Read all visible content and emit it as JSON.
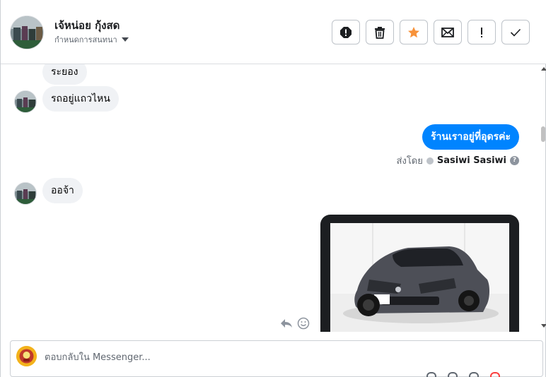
{
  "header": {
    "contact_name": "เจ้หน่อย กุ้งสด",
    "assign_label": "กำหนดการสนทนา"
  },
  "actions": [
    {
      "name": "alert-icon"
    },
    {
      "name": "trash-icon"
    },
    {
      "name": "star-icon"
    },
    {
      "name": "envelope-icon"
    },
    {
      "name": "exclamation-icon"
    },
    {
      "name": "checkmark-icon"
    }
  ],
  "messages": {
    "m1": "ระยอง",
    "m2": "รถอยู่แถวไหน",
    "m3": "ร้านเราอยู่ที่อุดรค่ะ",
    "m4": "ออจ้า"
  },
  "sent_by": {
    "label": "ส่งโดย",
    "name": "Sasiwi Sasiwi",
    "help": "?"
  },
  "composer": {
    "placeholder": "ตอบกลับใน Messenger..."
  },
  "colors": {
    "accent": "#0084ff",
    "star": "#f7923a",
    "incoming_bubble": "#f0f2f5"
  }
}
